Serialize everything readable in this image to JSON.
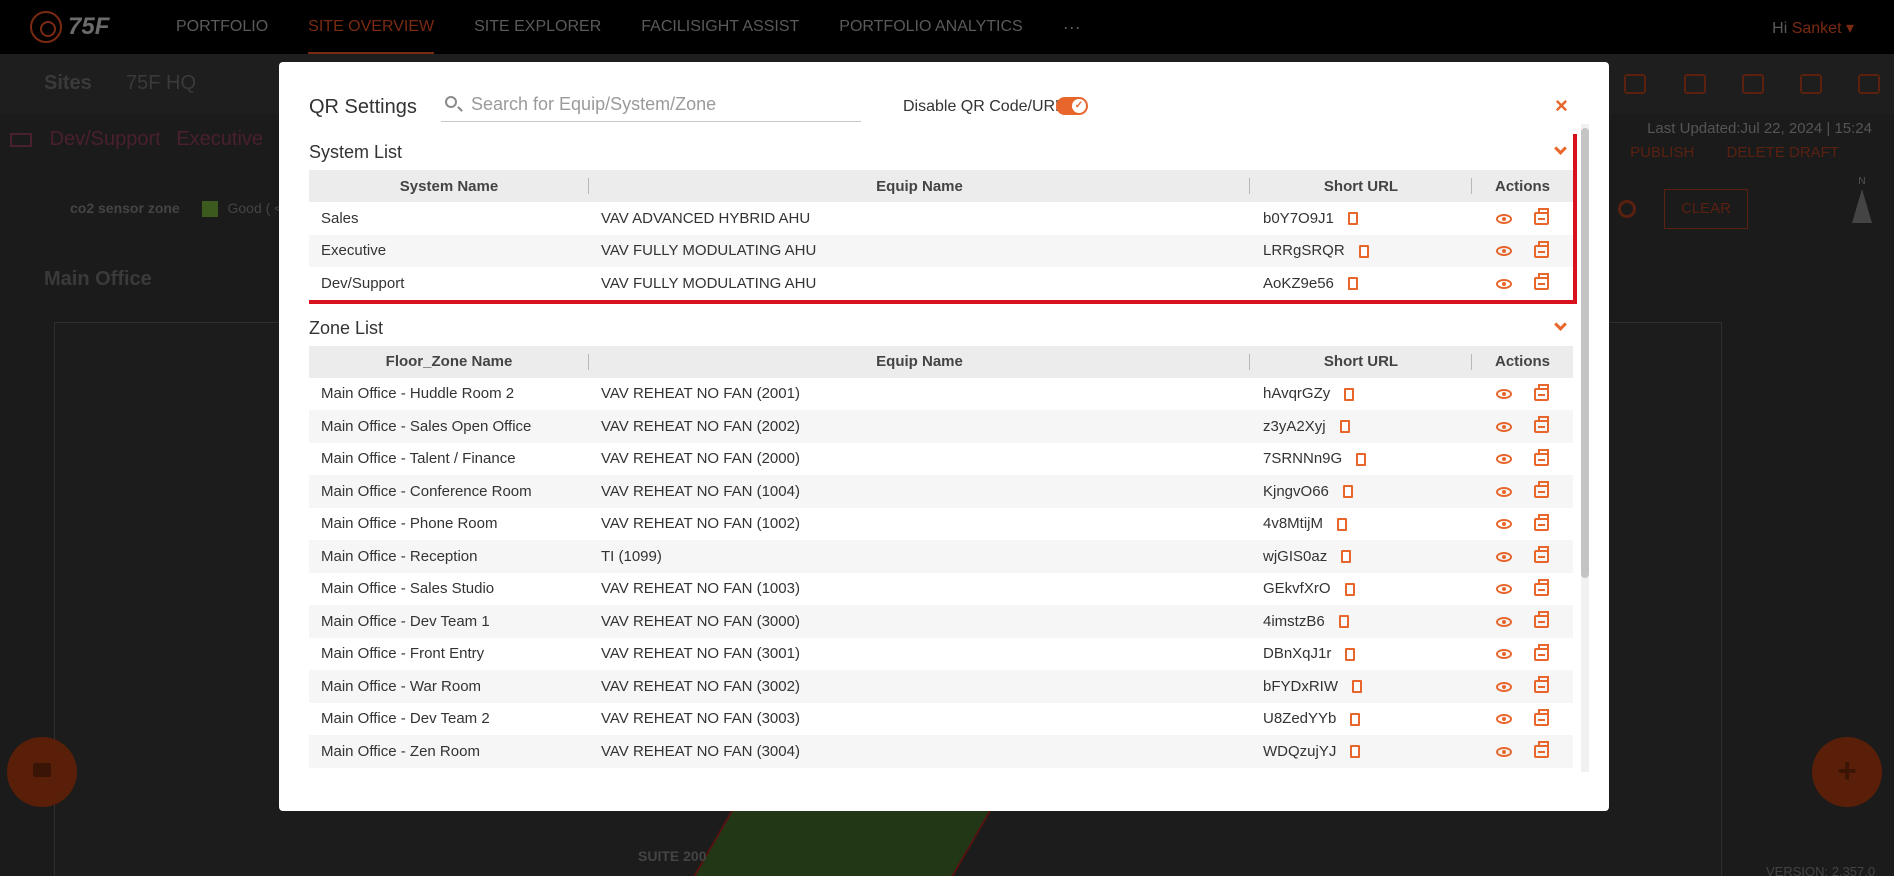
{
  "topnav": {
    "brand": "75F",
    "items": [
      "PORTFOLIO",
      "SITE OVERVIEW",
      "SITE EXPLORER",
      "FACILISIGHT ASSIST",
      "PORTFOLIO ANALYTICS"
    ],
    "more": "···",
    "greeting": "Hi",
    "user": "Sanket"
  },
  "subbar": {
    "sites_label": "Sites",
    "site_name": "75F HQ"
  },
  "background": {
    "crumbs": [
      "Dev/Support",
      "Executive"
    ],
    "last_updated": "Last Updated:Jul 22, 2024 | 15:24",
    "publish": "PUBLISH",
    "delete_draft": "DELETE DRAFT",
    "legend_label": "co2 sensor zone",
    "legend_good": "Good ( <=",
    "clear": "CLEAR",
    "compass": "N",
    "main_office": "Main Office",
    "suite": "SUITE 200",
    "version": "VERSION: 2.357.0"
  },
  "modal": {
    "title": "QR Settings",
    "search_placeholder": "Search for Equip/System/Zone",
    "toggle_label": "Disable QR Code/URL",
    "close": "×",
    "system_list": {
      "title": "System List",
      "headers": [
        "System Name",
        "Equip Name",
        "Short URL",
        "Actions"
      ],
      "rows": [
        {
          "name": "Sales",
          "equip": "VAV ADVANCED HYBRID AHU",
          "url": "b0Y7O9J1"
        },
        {
          "name": "Executive",
          "equip": "VAV FULLY MODULATING AHU",
          "url": "LRRgSRQR"
        },
        {
          "name": "Dev/Support",
          "equip": "VAV FULLY MODULATING AHU",
          "url": "AoKZ9e56"
        }
      ]
    },
    "zone_list": {
      "title": "Zone List",
      "headers": [
        "Floor_Zone Name",
        "Equip Name",
        "Short URL",
        "Actions"
      ],
      "rows": [
        {
          "name": "Main Office - Huddle Room 2",
          "equip": "VAV REHEAT NO FAN (2001)",
          "url": "hAvqrGZy"
        },
        {
          "name": "Main Office - Sales Open Office",
          "equip": "VAV REHEAT NO FAN (2002)",
          "url": "z3yA2Xyj"
        },
        {
          "name": "Main Office - Talent / Finance",
          "equip": "VAV REHEAT NO FAN (2000)",
          "url": "7SRNNn9G"
        },
        {
          "name": "Main Office - Conference Room",
          "equip": "VAV REHEAT NO FAN (1004)",
          "url": "KjngvO66"
        },
        {
          "name": "Main Office - Phone Room",
          "equip": "VAV REHEAT NO FAN (1002)",
          "url": "4v8MtijM"
        },
        {
          "name": "Main Office - Reception",
          "equip": "TI (1099)",
          "url": "wjGIS0az"
        },
        {
          "name": "Main Office - Sales Studio",
          "equip": "VAV REHEAT NO FAN (1003)",
          "url": "GEkvfXrO"
        },
        {
          "name": "Main Office - Dev Team 1",
          "equip": "VAV REHEAT NO FAN (3000)",
          "url": "4imstzB6"
        },
        {
          "name": "Main Office - Front Entry",
          "equip": "VAV REHEAT NO FAN (3001)",
          "url": "DBnXqJ1r"
        },
        {
          "name": "Main Office - War Room",
          "equip": "VAV REHEAT NO FAN (3002)",
          "url": "bFYDxRIW"
        },
        {
          "name": "Main Office - Dev Team 2",
          "equip": "VAV REHEAT NO FAN (3003)",
          "url": "U8ZedYYb"
        },
        {
          "name": "Main Office - Zen Room",
          "equip": "VAV REHEAT NO FAN (3004)",
          "url": "WDQzujYJ"
        }
      ]
    }
  },
  "colors": {
    "accent": "#e8662b",
    "highlight": "#d8121c"
  }
}
